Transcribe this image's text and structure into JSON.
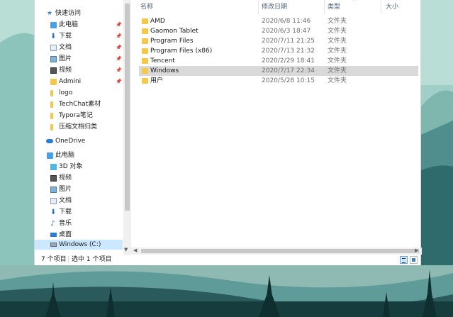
{
  "nav": {
    "quick_access": "快速访问",
    "items": [
      {
        "label": "此电脑",
        "pinned": true
      },
      {
        "label": "下载",
        "pinned": true
      },
      {
        "label": "文档",
        "pinned": true
      },
      {
        "label": "图片",
        "pinned": true
      },
      {
        "label": "视频",
        "pinned": true
      },
      {
        "label": "Admini",
        "pinned": true
      },
      {
        "label": "logo",
        "pinned": false
      },
      {
        "label": "TechChat素材",
        "pinned": false
      },
      {
        "label": "Typora笔记",
        "pinned": false
      },
      {
        "label": "压缩文档归类",
        "pinned": false
      }
    ],
    "onedrive": "OneDrive",
    "this_pc": "此电脑",
    "pc_items": [
      "3D 对象",
      "视频",
      "图片",
      "文档",
      "下载",
      "音乐",
      "桌面",
      "Windows (C:)"
    ],
    "pin_glyph": "📌"
  },
  "columns": {
    "name": "名称",
    "date": "修改日期",
    "type": "类型",
    "size": "大小"
  },
  "files": [
    {
      "name": "AMD",
      "date": "2020/6/8 11:46",
      "type": "文件夹"
    },
    {
      "name": "Gaomon Tablet",
      "date": "2020/6/3 18:47",
      "type": "文件夹"
    },
    {
      "name": "Program Files",
      "date": "2020/7/11 21:25",
      "type": "文件夹"
    },
    {
      "name": "Program Files (x86)",
      "date": "2020/7/13 21:32",
      "type": "文件夹"
    },
    {
      "name": "Tencent",
      "date": "2020/2/29 18:41",
      "type": "文件夹"
    },
    {
      "name": "Windows",
      "date": "2020/7/17 22:34",
      "type": "文件夹"
    },
    {
      "name": "用户",
      "date": "2020/5/28 10:15",
      "type": "文件夹"
    }
  ],
  "status": {
    "count": "7 个项目",
    "selected": "选中 1 个项目"
  },
  "colors": {
    "folder": "#f5c84b",
    "selection": "#cce8ff",
    "row_selected": "#d9d9d9"
  }
}
